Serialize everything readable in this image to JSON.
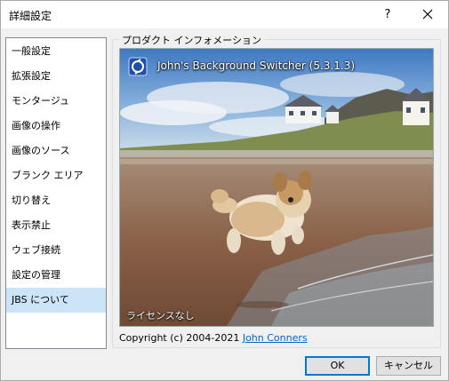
{
  "window": {
    "title": "詳細設定",
    "help_label": "?"
  },
  "sidebar": {
    "items": [
      {
        "label": "一般設定"
      },
      {
        "label": "拡張設定"
      },
      {
        "label": "モンタージュ"
      },
      {
        "label": "画像の操作"
      },
      {
        "label": "画像のソース"
      },
      {
        "label": "ブランク エリア"
      },
      {
        "label": "切り替え"
      },
      {
        "label": "表示禁止"
      },
      {
        "label": "ウェブ接続"
      },
      {
        "label": "設定の管理"
      },
      {
        "label": "JBS について",
        "selected": true
      }
    ]
  },
  "info": {
    "group_label": "プロダクト インフォメーション",
    "app_title": "John's Background Switcher (5.3.1.3)",
    "license_text": "ライセンスなし",
    "app_icon": "jbs-app-icon",
    "copyright_prefix": "Copyright (c) 2004-2021 ",
    "author": "John Conners",
    "link_color": "#0066cc"
  },
  "buttons": {
    "ok": "OK",
    "cancel": "キャンセル"
  },
  "colors": {
    "selection": "#cce4f7",
    "accent": "#0078d7"
  }
}
